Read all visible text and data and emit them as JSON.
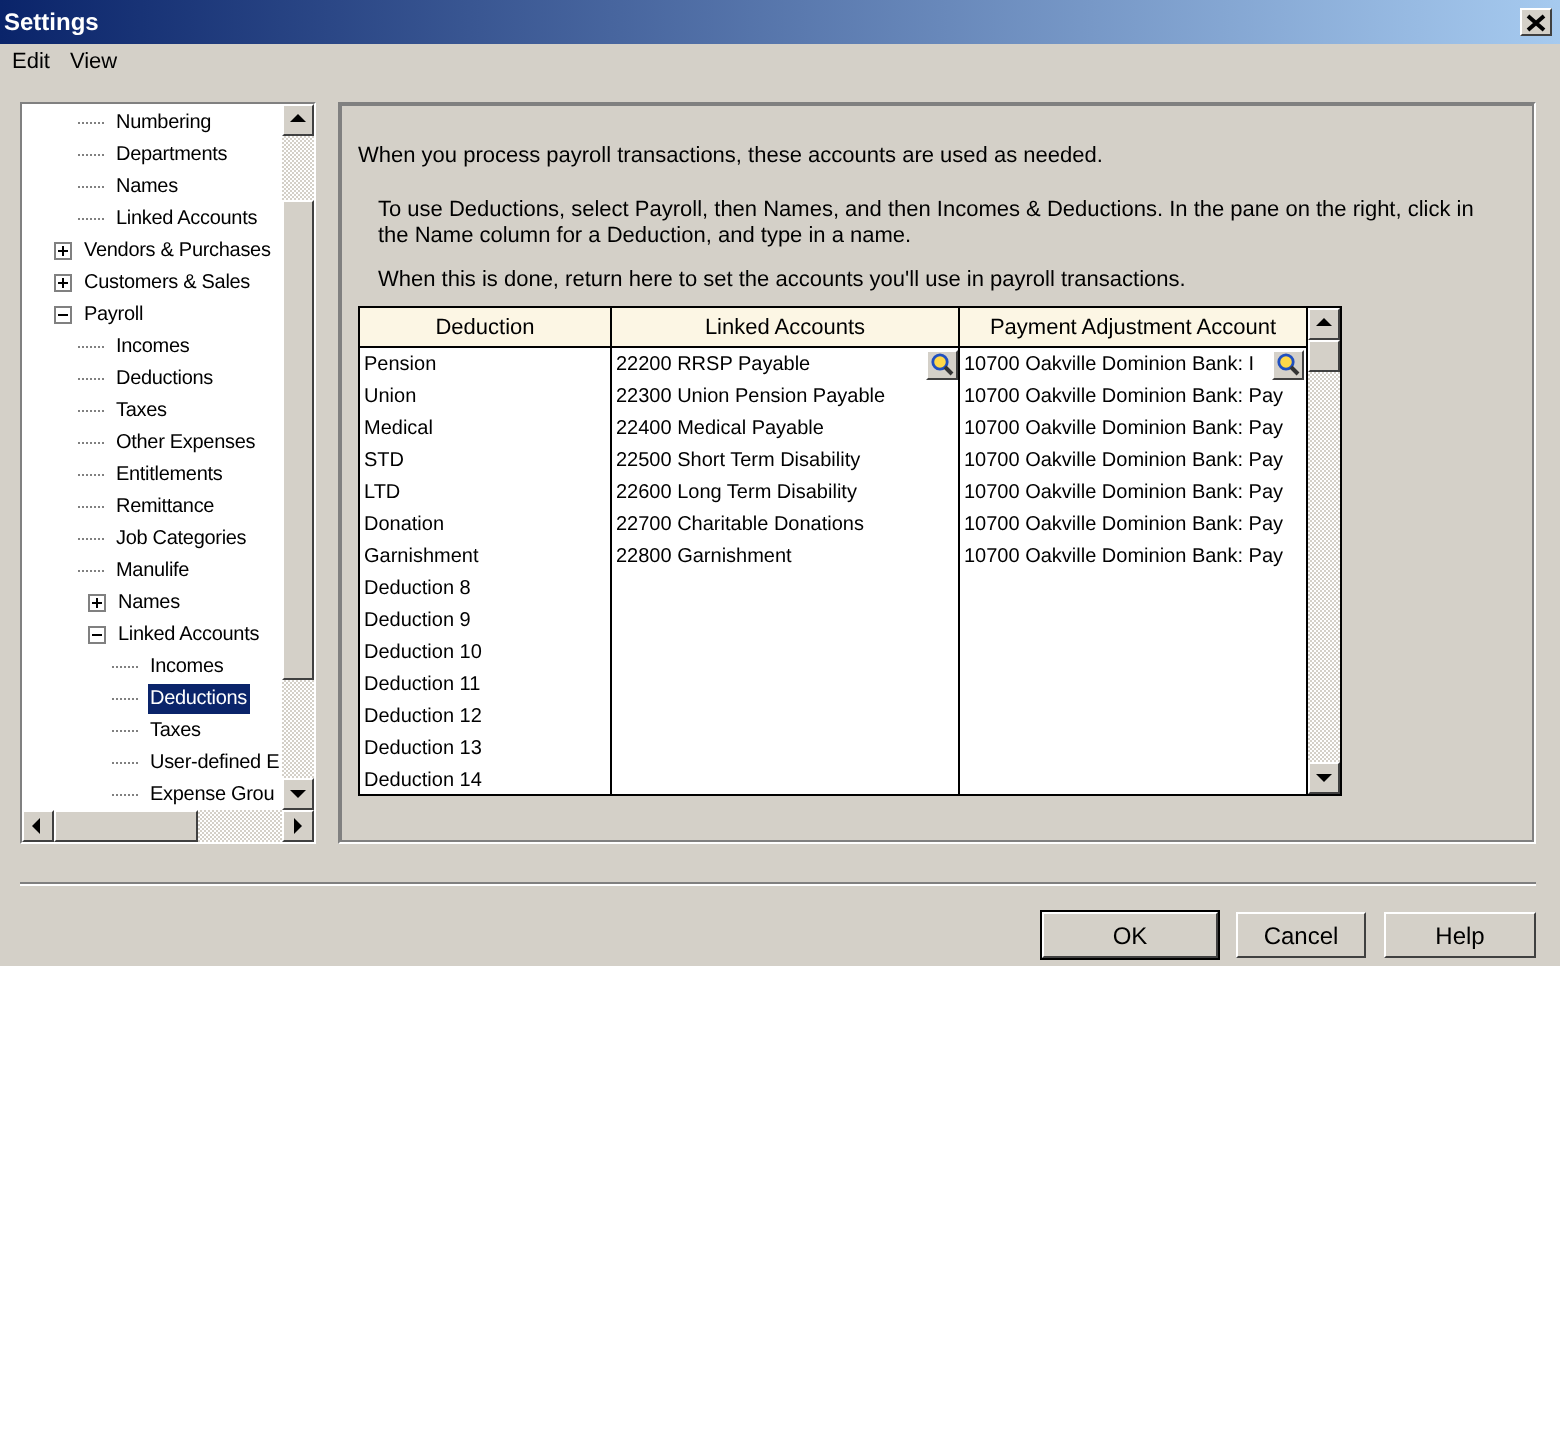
{
  "window": {
    "title": "Settings"
  },
  "menu": [
    "Edit",
    "View"
  ],
  "tree": [
    {
      "children": [
        {
          "label": "Numbering",
          "selected": false
        },
        {
          "label": "Departments",
          "selected": false
        },
        {
          "label": "Names",
          "selected": false
        },
        {
          "label": "Linked Accounts",
          "selected": false
        }
      ]
    },
    {
      "label": "Vendors & Purchases",
      "expanded": false,
      "selected": false
    },
    {
      "label": "Customers & Sales",
      "expanded": false,
      "selected": false
    },
    {
      "label": "Payroll",
      "expanded": true,
      "selected": false,
      "children": [
        {
          "label": "Incomes",
          "selected": false
        },
        {
          "label": "Deductions",
          "selected": false
        },
        {
          "label": "Taxes",
          "selected": false
        },
        {
          "label": "Other Expenses",
          "selected": false
        },
        {
          "label": "Entitlements",
          "selected": false
        },
        {
          "label": "Remittance",
          "selected": false
        },
        {
          "label": "Job Categories",
          "selected": false
        },
        {
          "label": "Manulife",
          "selected": false
        },
        {
          "label": "Names",
          "expanded": false,
          "selected": false
        },
        {
          "label": "Linked Accounts",
          "expanded": true,
          "selected": false,
          "children": [
            {
              "label": "Incomes",
              "selected": false
            },
            {
              "label": "Deductions",
              "selected": true
            },
            {
              "label": "Taxes",
              "selected": false
            },
            {
              "label": "User-defined E",
              "selected": false
            },
            {
              "label": "Expense Grou",
              "selected": false
            }
          ]
        }
      ]
    }
  ],
  "intro": "When you process payroll transactions, these accounts are used as needed.",
  "instructions": [
    "To use Deductions, select Payroll, then Names, and then Incomes & Deductions. In the pane on the right, click in the Name column for a Deduction, and type in a name.",
    "When this is done, return here to set the accounts you'll use in payroll transactions."
  ],
  "table": {
    "columns": [
      "Deduction",
      "Linked Accounts",
      "Payment Adjustment Account"
    ],
    "rows": [
      {
        "cells": [
          "Pension",
          "22200 RRSP Payable",
          "10700 Oakville Dominion Bank: I"
        ],
        "active": true
      },
      {
        "cells": [
          "Union",
          "22300 Union Pension Payable",
          "10700 Oakville Dominion Bank: Pay"
        ],
        "active": false
      },
      {
        "cells": [
          "Medical",
          "22400 Medical Payable",
          "10700 Oakville Dominion Bank: Pay"
        ],
        "active": false
      },
      {
        "cells": [
          "STD",
          "22500 Short Term Disability",
          "10700 Oakville Dominion Bank: Pay"
        ],
        "active": false
      },
      {
        "cells": [
          "LTD",
          "22600 Long Term Disability",
          "10700 Oakville Dominion Bank: Pay"
        ],
        "active": false
      },
      {
        "cells": [
          "Donation",
          "22700 Charitable Donations",
          "10700 Oakville Dominion Bank: Pay"
        ],
        "active": false
      },
      {
        "cells": [
          "Garnishment",
          "22800 Garnishment",
          "10700 Oakville Dominion Bank: Pay"
        ],
        "active": false
      },
      {
        "cells": [
          "Deduction 8"
        ],
        "active": false
      },
      {
        "cells": [
          "Deduction 9"
        ],
        "active": false
      },
      {
        "cells": [
          "Deduction 10"
        ],
        "active": false
      },
      {
        "cells": [
          "Deduction 11"
        ],
        "active": false
      },
      {
        "cells": [
          "Deduction 12"
        ],
        "active": false
      },
      {
        "cells": [
          "Deduction 13"
        ],
        "active": false
      },
      {
        "cells": [
          "Deduction 14"
        ],
        "active": false
      }
    ]
  },
  "buttons": [
    {
      "label": "OK",
      "default": true
    },
    {
      "label": "Cancel",
      "default": false
    },
    {
      "label": "Help",
      "default": false
    }
  ]
}
